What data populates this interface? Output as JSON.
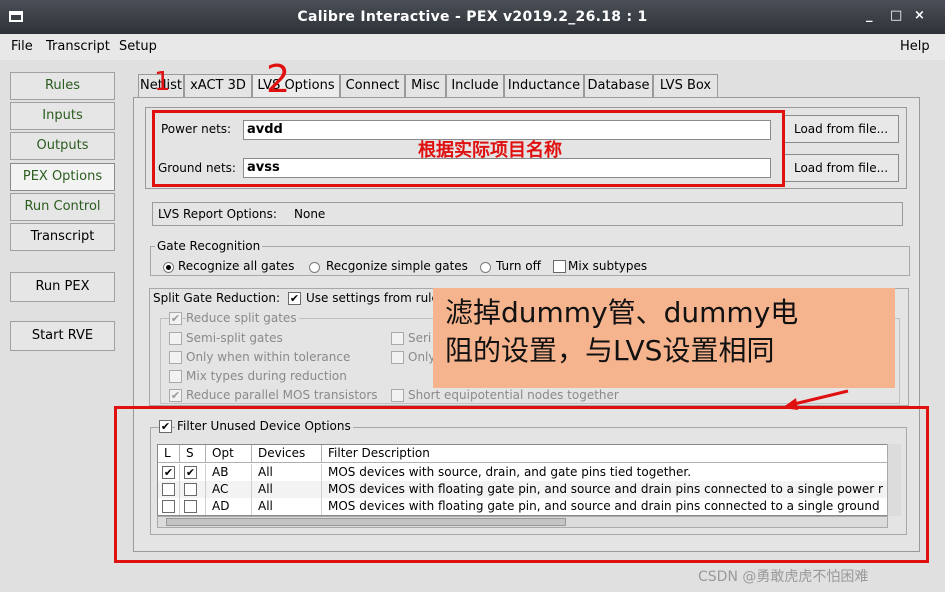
{
  "window": {
    "title": "Calibre Interactive - PEX v2019.2_26.18 : 1",
    "controls": [
      "_",
      "□",
      "×"
    ]
  },
  "menubar": {
    "file": "File",
    "transcript": "Transcript",
    "setup": "Setup",
    "help": "Help"
  },
  "nav": {
    "rules": "Rules",
    "inputs": "Inputs",
    "outputs": "Outputs",
    "pex_options": "PEX Options",
    "run_control": "Run Control",
    "transcript": "Transcript",
    "run_pex": "Run PEX",
    "start_rve": "Start RVE"
  },
  "tabs": [
    "Netlist",
    "xACT 3D",
    "LVS Options",
    "Connect",
    "Misc",
    "Include",
    "Inductance",
    "Database",
    "LVS Box"
  ],
  "nets": {
    "power_label": "Power nets:",
    "power_value": "avdd",
    "ground_label": "Ground nets:",
    "ground_value": "avss",
    "load_button": "Load from file..."
  },
  "lvs_report": {
    "label": "LVS Report Options:",
    "value": "None"
  },
  "gate_recognition": {
    "title": "Gate Recognition",
    "options": [
      "Recognize all gates",
      "Recgonize simple gates",
      "Turn off"
    ],
    "selected": "Recognize all gates",
    "mix_subtypes": "Mix subtypes"
  },
  "split_gate": {
    "title": "Split Gate Reduction:",
    "use_rules_label": "Use settings from rule",
    "reduce_split_gates": "Reduce split gates",
    "semi_split_gates": "Semi-split gates",
    "only_within_tolerance": "Only when within tolerance",
    "mix_types": "Mix types during reduction",
    "reduce_parallel_mos": "Reduce parallel MOS transistors",
    "short_equipotential": "Short equipotential nodes together",
    "seri_partial": "Seri",
    "only_partial": "Only"
  },
  "filter": {
    "title": "Filter Unused Device Options",
    "headers": [
      "L",
      "S",
      "Opt",
      "Devices",
      "Filter Description"
    ],
    "rows": [
      {
        "l": true,
        "s": true,
        "opt": "AB",
        "devices": "All",
        "desc": "MOS devices with source, drain, and gate pins tied together."
      },
      {
        "l": false,
        "s": false,
        "opt": "AC",
        "devices": "All",
        "desc": "MOS devices with floating gate pin, and source and drain pins connected to a single power r"
      },
      {
        "l": false,
        "s": false,
        "opt": "AD",
        "devices": "All",
        "desc": "MOS devices with floating gate pin, and source and drain pins connected to a single ground"
      }
    ]
  },
  "annotations": {
    "num1": "1",
    "num2": "2",
    "red_label": "根据实际项目名称",
    "note_line1": "滤掉dummy管、dummy电",
    "note_line2": "阻的设置，与LVS设置相同"
  },
  "watermark": "CSDN @勇敢虎虎不怕困难",
  "colors": {
    "annotation_red": "#e01010",
    "note_bg": "#f6b48e",
    "nav_text": "#2a5c1e"
  }
}
